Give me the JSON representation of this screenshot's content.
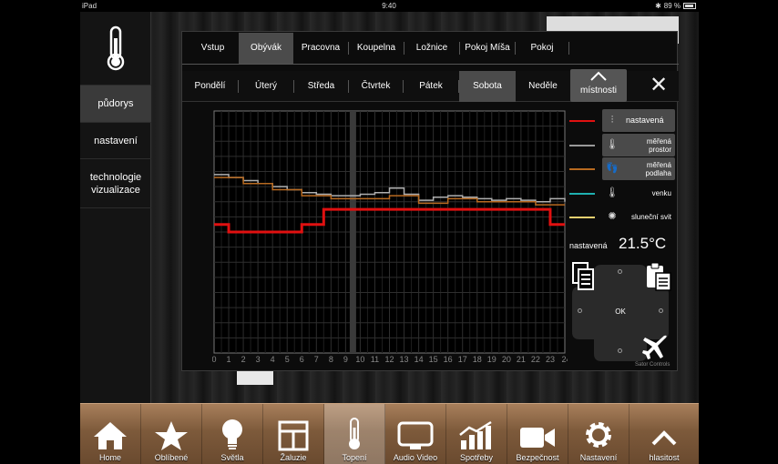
{
  "status": {
    "device": "iPad",
    "time": "9:40",
    "battery": "89 %"
  },
  "sidebar": {
    "items": [
      "půdorys",
      "nastavení",
      "technologie vizualizace"
    ]
  },
  "rooms": [
    "Vstup",
    "Obývák",
    "Pracovna",
    "Koupelna",
    "Ložnice",
    "Pokoj Míša",
    "Pokoj"
  ],
  "selected_room": "Obývák",
  "days": [
    "Pondělí",
    "Úterý",
    "Středa",
    "Čtvrtek",
    "Pátek",
    "Sobota",
    "Neděle"
  ],
  "selected_day": "Sobota",
  "rooms_button": "místnosti",
  "legend": {
    "items": [
      {
        "label": "nastavená",
        "color": "#e01010",
        "icon": "settings-sliders-icon",
        "active": true
      },
      {
        "label": "měřená prostor",
        "color": "#9a9a9a",
        "icon": "thermometer-icon",
        "active": true
      },
      {
        "label": "měřená podlaha",
        "color": "#b86a20",
        "icon": "footprints-icon",
        "active": true
      },
      {
        "label": "venku",
        "color": "#1fb0b0",
        "icon": "thermometer-icon",
        "active": false
      },
      {
        "label": "sluneční svit",
        "color": "#e8d070",
        "icon": "sun-icon",
        "active": false
      }
    ]
  },
  "setpoint": {
    "label": "nastavená",
    "value": "21.5°C"
  },
  "dpad": {
    "ok": "OK"
  },
  "brand": "Sator Controls",
  "chart_data": {
    "type": "line",
    "x_ticks": [
      "0",
      "1",
      "2",
      "3",
      "4",
      "5",
      "6",
      "7",
      "8",
      "9",
      "10",
      "11",
      "12",
      "13",
      "14",
      "15",
      "16",
      "17",
      "18",
      "19",
      "20",
      "21",
      "22",
      "23",
      "24h"
    ],
    "xlim": [
      0,
      24
    ],
    "current_time": 9.5,
    "grid": true,
    "series": [
      {
        "name": "nastavená",
        "color": "#e01010",
        "step": true,
        "points": [
          [
            0,
            20.5
          ],
          [
            1,
            20.0
          ],
          [
            6,
            20.0
          ],
          [
            6,
            20.5
          ],
          [
            7.5,
            20.5
          ],
          [
            7.5,
            21.5
          ],
          [
            23,
            21.5
          ],
          [
            23,
            20.5
          ],
          [
            24,
            20.5
          ]
        ]
      },
      {
        "name": "měřená prostor",
        "color": "#b0b0b0",
        "step": true,
        "points": [
          [
            0,
            23.8
          ],
          [
            1,
            23.6
          ],
          [
            2,
            23.4
          ],
          [
            3,
            23.2
          ],
          [
            4,
            23.0
          ],
          [
            5,
            22.8
          ],
          [
            6,
            22.6
          ],
          [
            7,
            22.5
          ],
          [
            8,
            22.4
          ],
          [
            9,
            22.4
          ],
          [
            10,
            22.5
          ],
          [
            11,
            22.6
          ],
          [
            12,
            22.9
          ],
          [
            13,
            22.5
          ],
          [
            14,
            22.1
          ],
          [
            15,
            22.3
          ],
          [
            16,
            22.4
          ],
          [
            17,
            22.3
          ],
          [
            18,
            22.2
          ],
          [
            19,
            22.1
          ],
          [
            20,
            22.2
          ],
          [
            21,
            22.1
          ],
          [
            22,
            22.0
          ],
          [
            23,
            22.2
          ],
          [
            24,
            22.0
          ]
        ]
      },
      {
        "name": "měřená podlaha",
        "color": "#b86a20",
        "step": true,
        "points": [
          [
            0,
            23.6
          ],
          [
            2,
            23.2
          ],
          [
            4,
            22.8
          ],
          [
            6,
            22.4
          ],
          [
            8,
            22.2
          ],
          [
            10,
            22.2
          ],
          [
            12,
            22.4
          ],
          [
            14,
            21.9
          ],
          [
            16,
            22.2
          ],
          [
            18,
            22.0
          ],
          [
            20,
            22.0
          ],
          [
            22,
            21.8
          ],
          [
            24,
            21.8
          ]
        ]
      }
    ]
  },
  "toolbar": {
    "items": [
      "Home",
      "Oblíbené",
      "Světla",
      "Žaluzie",
      "Topení",
      "Audio Video",
      "Spotřeby",
      "Bezpečnost",
      "Nastavení",
      "hlasitost"
    ],
    "selected": "Topení"
  }
}
